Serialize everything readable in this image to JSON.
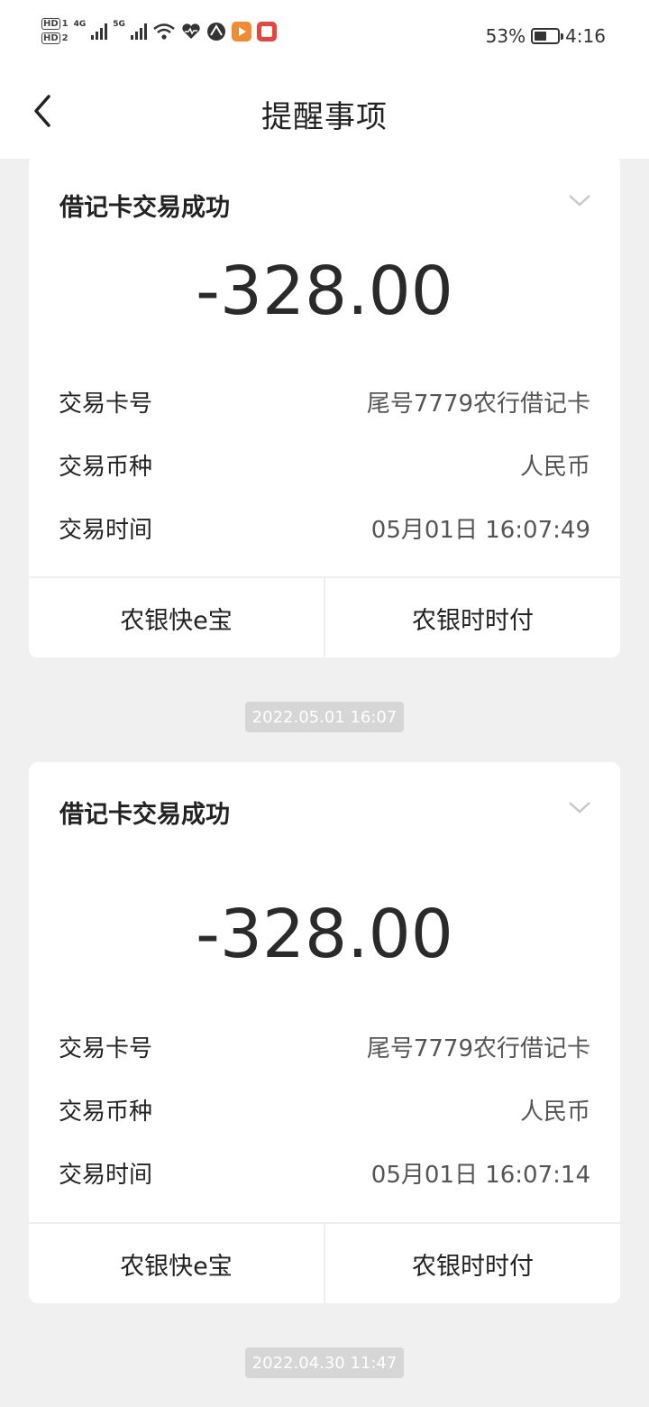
{
  "status_bar": {
    "hd_top": "HD",
    "hd_top_sub": "1",
    "hd_bottom": "HD",
    "hd_bottom_sub": "2",
    "net1": "4G",
    "net2": "5G",
    "battery_percent": "53%",
    "battery_level": 0.53,
    "time": "4:16",
    "icons": [
      "signal-icon",
      "signal-icon",
      "wifi-icon",
      "health-heart-icon",
      "browser-icon",
      "video-app-icon",
      "reader-app-icon",
      "battery-icon"
    ]
  },
  "header": {
    "title": "提醒事项",
    "back_icon": "chevron-left-icon"
  },
  "messages": [
    {
      "title": "借记卡交易成功",
      "amount": "-328.00",
      "rows": [
        {
          "label": "交易卡号",
          "value": "尾号7779农行借记卡"
        },
        {
          "label": "交易币种",
          "value": "人民币"
        },
        {
          "label": "交易时间",
          "value": "05月01日 16:07:49"
        }
      ],
      "buttons": [
        "农银快e宝",
        "农银时时付"
      ]
    },
    {
      "timestamp": "2022.05.01 16:07",
      "title": "借记卡交易成功",
      "amount": "-328.00",
      "rows": [
        {
          "label": "交易卡号",
          "value": "尾号7779农行借记卡"
        },
        {
          "label": "交易币种",
          "value": "人民币"
        },
        {
          "label": "交易时间",
          "value": "05月01日 16:07:14"
        }
      ],
      "buttons": [
        "农银快e宝",
        "农银时时付"
      ]
    },
    {
      "timestamp": "2022.04.30 11:47"
    }
  ],
  "colors": {
    "background": "#f0f0f0",
    "card": "#ffffff",
    "badge": "#d6d6d6",
    "app_orange": "#f08a33",
    "app_red": "#e8453c"
  }
}
